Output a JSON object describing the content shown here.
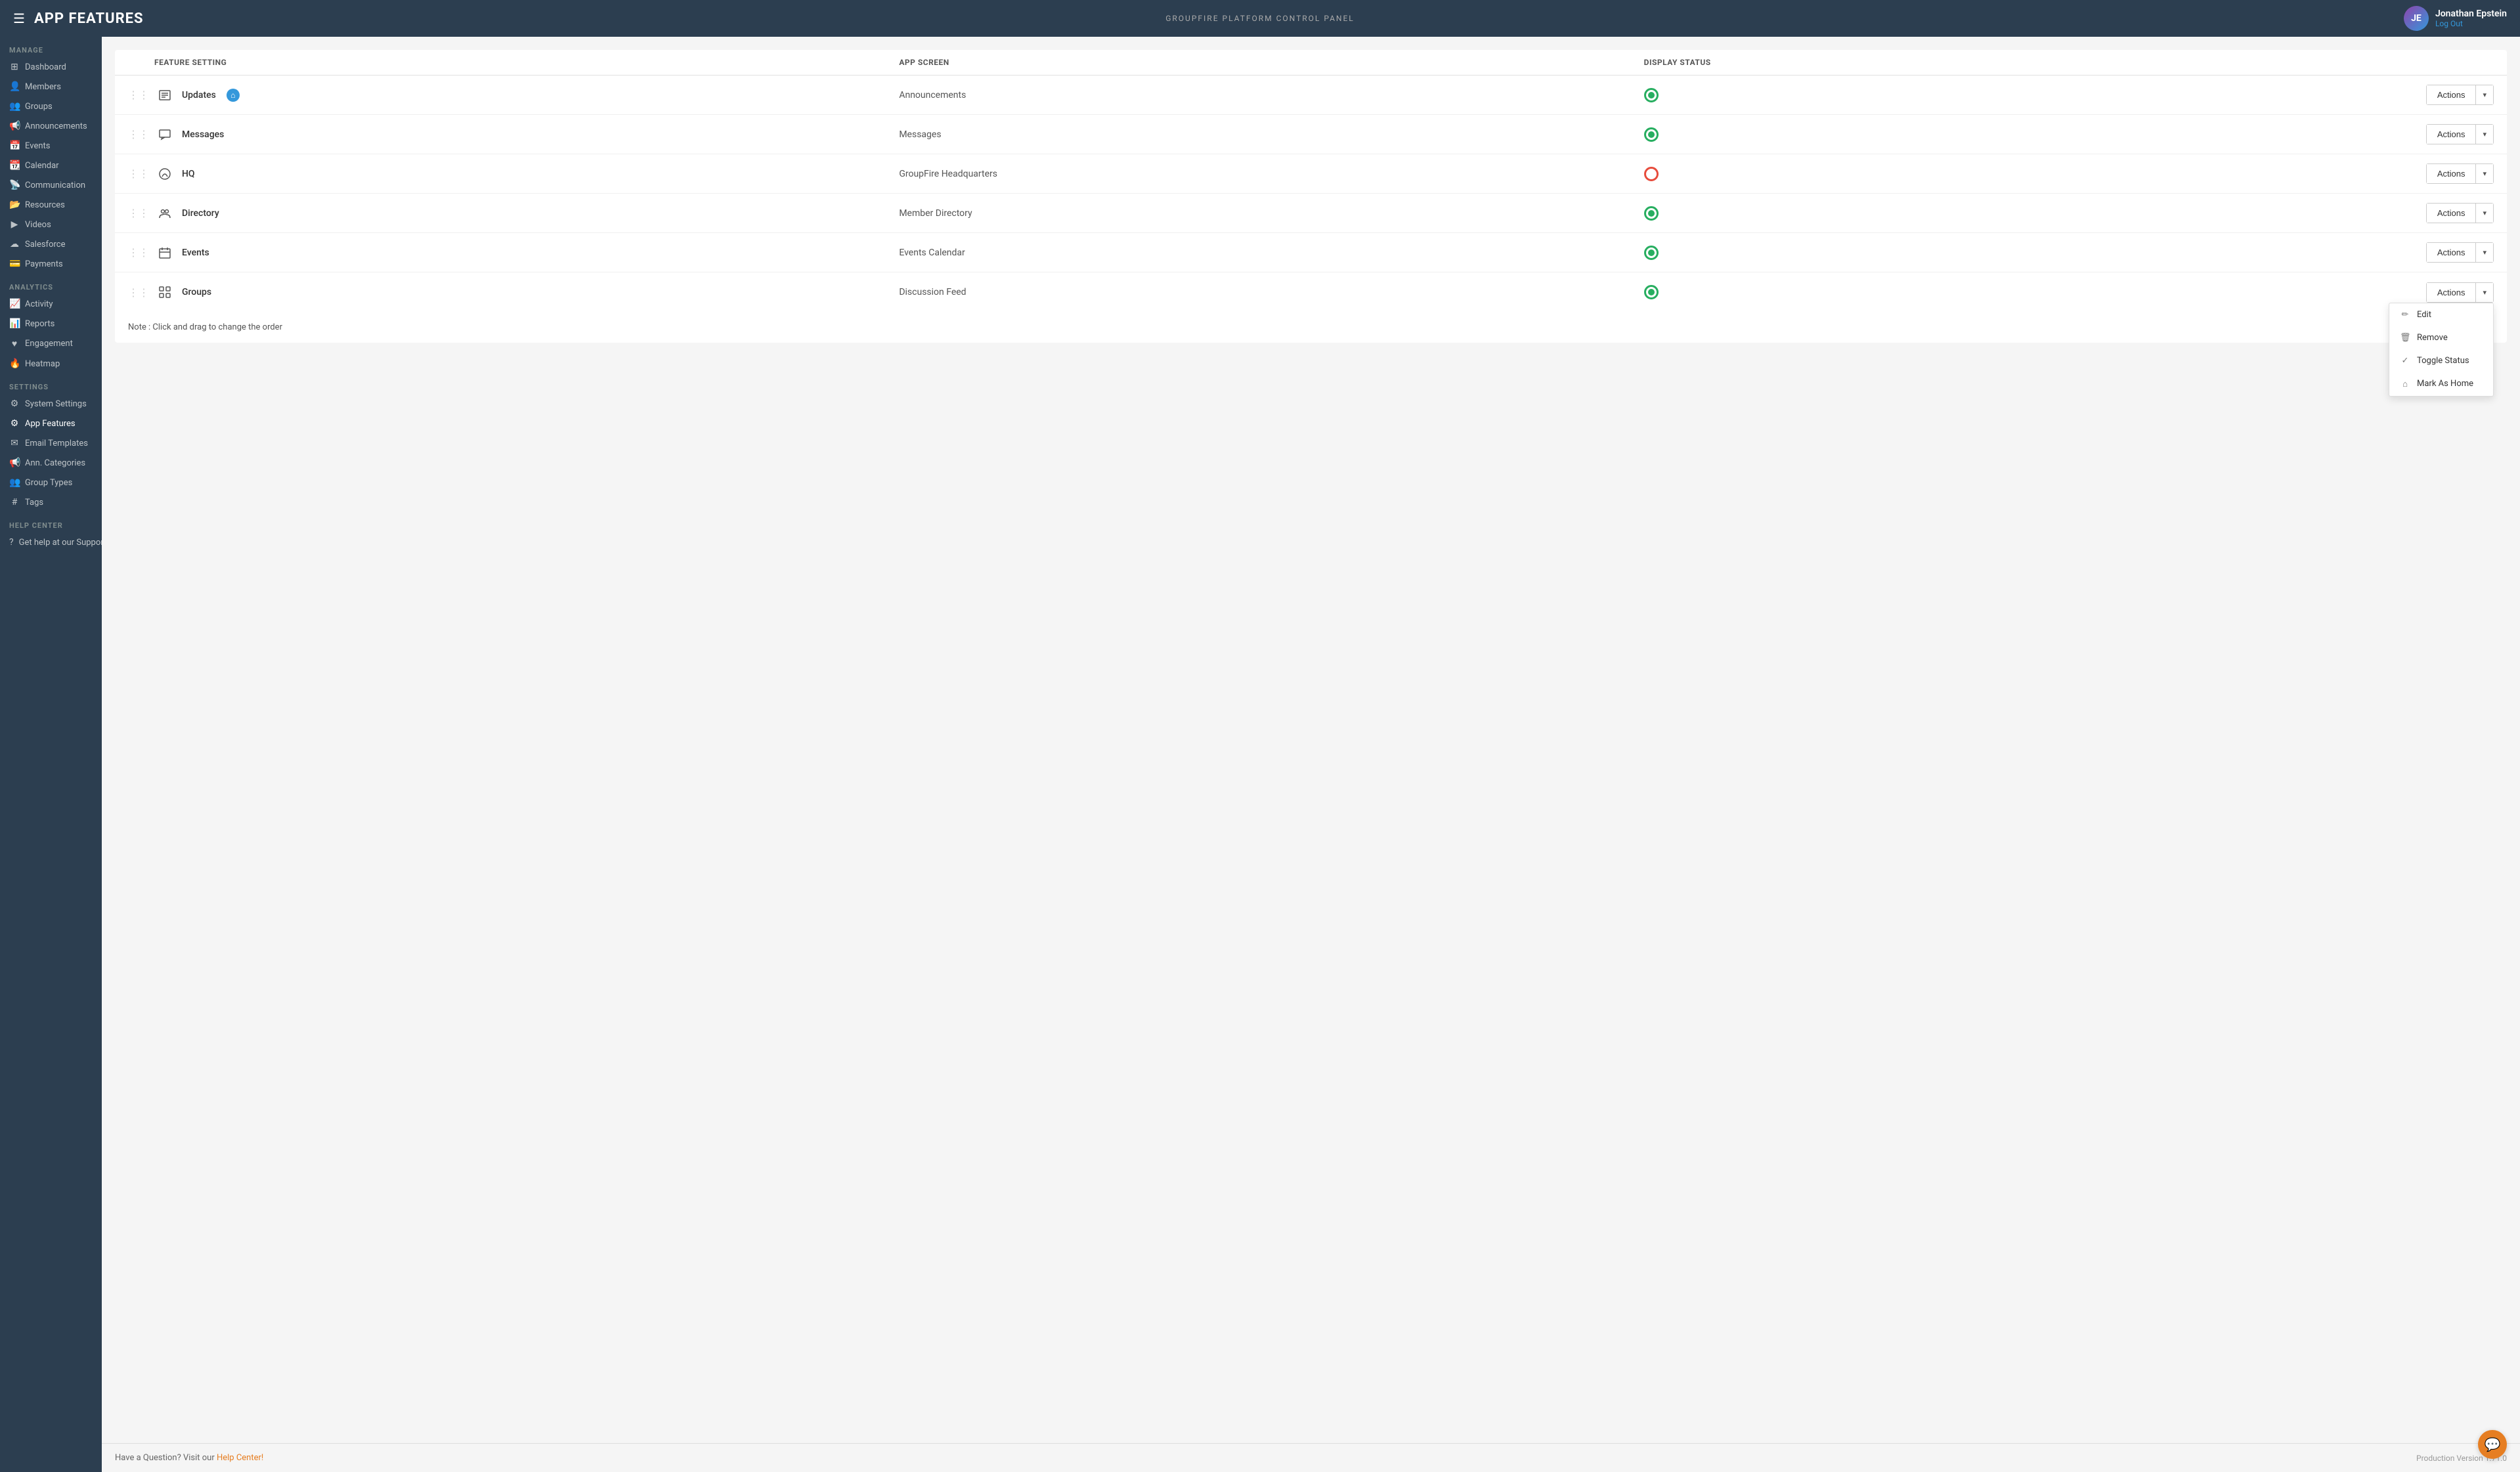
{
  "header": {
    "hamburger": "☰",
    "title": "APP FEATURES",
    "center_label": "GROUPFIRE PLATFORM CONTROL PANEL",
    "user_name": "Jonathan Epstein",
    "logout_label": "Log Out",
    "avatar_initials": "JE"
  },
  "sidebar": {
    "sections": [
      {
        "label": "MANAGE",
        "items": [
          {
            "icon": "⊞",
            "label": "Dashboard"
          },
          {
            "icon": "👤",
            "label": "Members"
          },
          {
            "icon": "👥",
            "label": "Groups"
          },
          {
            "icon": "📢",
            "label": "Announcements"
          },
          {
            "icon": "📅",
            "label": "Events"
          },
          {
            "icon": "📆",
            "label": "Calendar"
          },
          {
            "icon": "📡",
            "label": "Communication"
          },
          {
            "icon": "📂",
            "label": "Resources"
          },
          {
            "icon": "▶",
            "label": "Videos"
          },
          {
            "icon": "☁",
            "label": "Salesforce"
          },
          {
            "icon": "💳",
            "label": "Payments"
          }
        ]
      },
      {
        "label": "ANALYTICS",
        "items": [
          {
            "icon": "📈",
            "label": "Activity"
          },
          {
            "icon": "📊",
            "label": "Reports"
          },
          {
            "icon": "♥",
            "label": "Engagement"
          },
          {
            "icon": "🔥",
            "label": "Heatmap"
          }
        ]
      },
      {
        "label": "SETTINGS",
        "items": [
          {
            "icon": "⚙",
            "label": "System Settings"
          },
          {
            "icon": "⚙",
            "label": "App Features",
            "active": true
          },
          {
            "icon": "✉",
            "label": "Email Templates"
          },
          {
            "icon": "📢",
            "label": "Ann. Categories"
          },
          {
            "icon": "👥",
            "label": "Group Types"
          },
          {
            "icon": "#",
            "label": "Tags"
          }
        ]
      },
      {
        "label": "HELP CENTER",
        "items": [
          {
            "icon": "?",
            "label": "Get help at our Support Center"
          }
        ]
      }
    ]
  },
  "table": {
    "columns": [
      {
        "label": ""
      },
      {
        "label": "FEATURE SETTING"
      },
      {
        "label": "APP SCREEN"
      },
      {
        "label": "DISPLAY STATUS"
      },
      {
        "label": ""
      }
    ],
    "rows": [
      {
        "id": 1,
        "icon": "📄",
        "name": "Updates",
        "is_home": true,
        "app_screen": "Announcements",
        "status": "active",
        "show_dropdown": false
      },
      {
        "id": 2,
        "icon": "💬",
        "name": "Messages",
        "is_home": false,
        "app_screen": "Messages",
        "status": "active",
        "show_dropdown": false
      },
      {
        "id": 3,
        "icon": "○",
        "name": "HQ",
        "is_home": false,
        "app_screen": "GroupFire Headquarters",
        "status": "inactive",
        "show_dropdown": false
      },
      {
        "id": 4,
        "icon": "👥",
        "name": "Directory",
        "is_home": false,
        "app_screen": "Member Directory",
        "status": "active",
        "show_dropdown": false
      },
      {
        "id": 5,
        "icon": "📅",
        "name": "Events",
        "is_home": false,
        "app_screen": "Events Calendar",
        "status": "active",
        "show_dropdown": false
      },
      {
        "id": 6,
        "icon": "⊞",
        "name": "Groups",
        "is_home": false,
        "app_screen": "Discussion Feed",
        "status": "active",
        "show_dropdown": true
      }
    ],
    "actions_label": "Actions",
    "actions_arrow": "▾",
    "dropdown_items": [
      {
        "icon": "✏",
        "label": "Edit"
      },
      {
        "icon": "🗑",
        "label": "Remove"
      },
      {
        "icon": "✓",
        "label": "Toggle Status"
      },
      {
        "icon": "⌂",
        "label": "Mark As Home"
      }
    ]
  },
  "note": "Note : Click and drag to change the order",
  "footer": {
    "question_text": "Have a Question? Visit our ",
    "help_link": "Help Center!",
    "version": "Production Version 1.71.0"
  }
}
